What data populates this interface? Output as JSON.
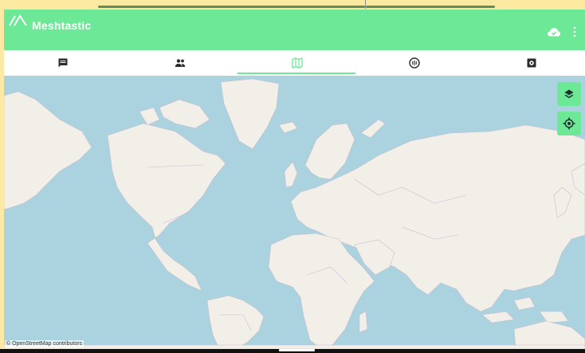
{
  "app": {
    "title": "Meshtastic",
    "accent": "#6ce896",
    "logo_icon": "meshtastic-logo-icon",
    "cloud_icon": "cloud-sync-icon",
    "menu_icon": "more-vert-icon"
  },
  "tabs": [
    {
      "name": "messages",
      "icon": "chat-icon",
      "selected": false
    },
    {
      "name": "nodes",
      "icon": "people-icon",
      "selected": false
    },
    {
      "name": "map",
      "icon": "map-icon",
      "selected": true
    },
    {
      "name": "channel",
      "icon": "radio-icon",
      "selected": false
    },
    {
      "name": "settings",
      "icon": "settings-icon",
      "selected": false
    }
  ],
  "map": {
    "attribution": "© OpenStreetMap contributors",
    "water_color": "#aad3df",
    "land_color": "#f2efe9",
    "layers_icon": "layers-icon",
    "locate_icon": "my-location-icon"
  }
}
